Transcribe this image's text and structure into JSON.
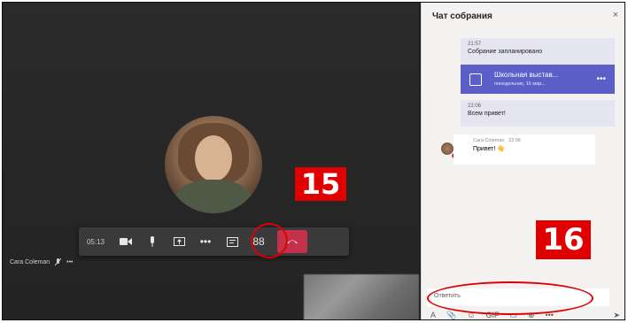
{
  "call": {
    "duration": "05:13",
    "participant_name": "Cara Coleman",
    "controls": {
      "camera_icon": "camera-icon",
      "mic_icon": "mic-icon",
      "share_icon": "share-icon",
      "more": "•••",
      "chat_icon": "chat-icon",
      "participants": "88",
      "hangup_icon": "hangup-icon"
    },
    "name_more": "•••"
  },
  "annotations": {
    "badge_left": "15",
    "badge_right": "16",
    "highlight_color": "#e00000"
  },
  "chat": {
    "title": "Чат собрания",
    "close": "×",
    "messages": [
      {
        "time": "21:57",
        "text": "Собрание запланировано"
      },
      {
        "time": "22:06",
        "text": "Всем привет!"
      }
    ],
    "meeting_card": {
      "title": "Школьная выстав...",
      "subtitle": "понедельник, 16 мар...",
      "more": "•••"
    },
    "incoming": {
      "sender": "Cara Coleman",
      "time": "22:06",
      "text": "Привет! 👋"
    },
    "reply_placeholder": "Ответить",
    "compose": [
      "A",
      "📎",
      "☺",
      "GIF",
      "▭",
      "⊕",
      "•••"
    ],
    "send": "➤"
  },
  "colors": {
    "accent": "#5b5fc7",
    "hangup": "#c4314b",
    "stage": "#262626"
  }
}
